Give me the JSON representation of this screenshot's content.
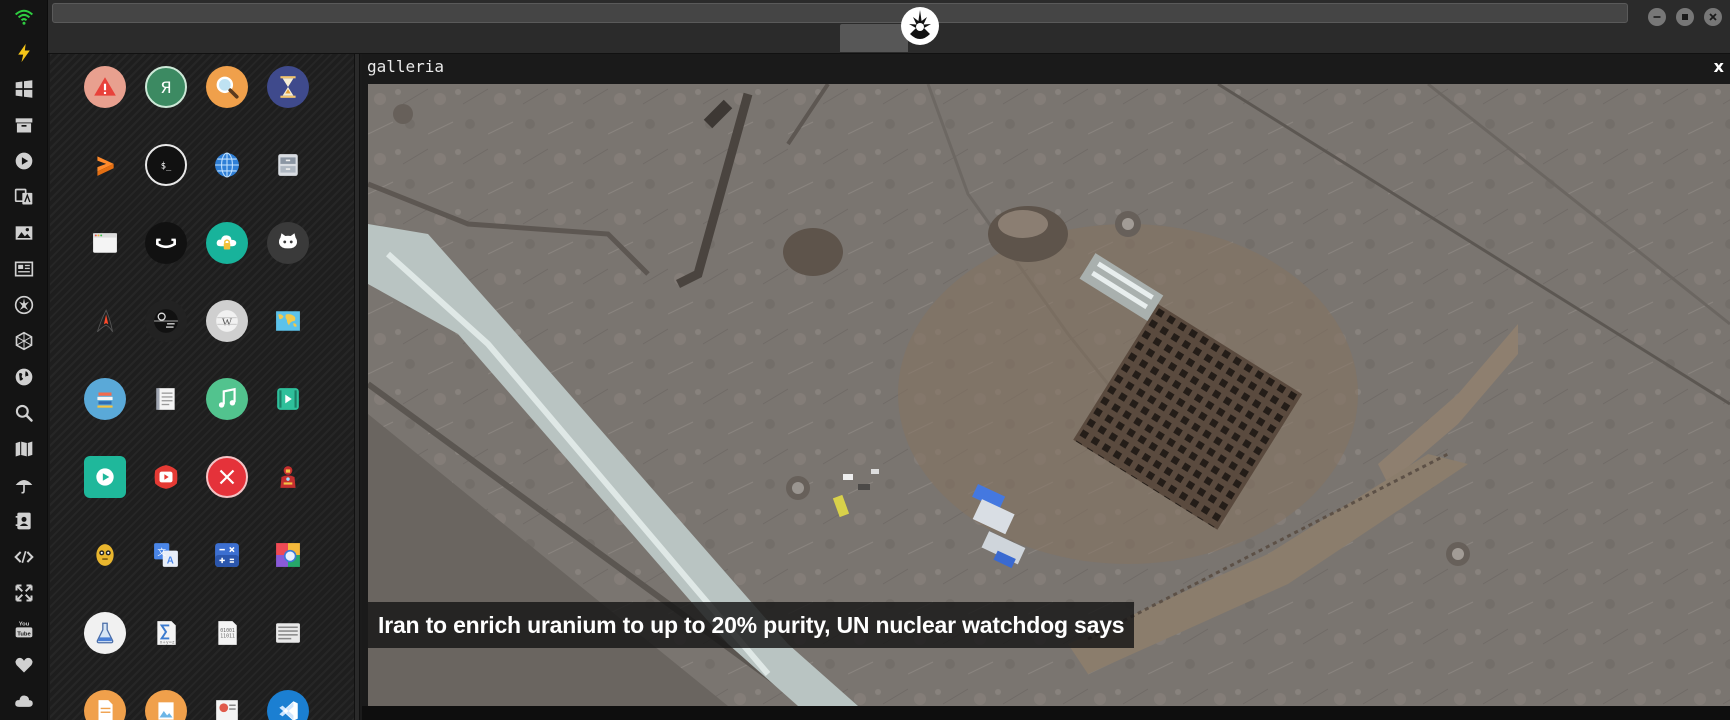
{
  "topbar": {
    "url_value": "",
    "buttons": [
      "minimize",
      "maximize",
      "close"
    ]
  },
  "dock": {
    "items": [
      "wifi-icon",
      "lightning-icon",
      "windows-icon",
      "archive-icon",
      "play-circle-icon",
      "translate-icon",
      "image-icon",
      "newspaper-icon",
      "rebel-alliance-icon",
      "hexagon-icon",
      "globe-icon",
      "search-icon",
      "map-icon",
      "umbrella-icon",
      "contacts-icon",
      "code-icon",
      "expand-icon",
      "youtube-icon",
      "heart-icon",
      "cloud-icon"
    ]
  },
  "apps": {
    "icons": [
      "warning-icon",
      "yandex-browser-icon",
      "search-icon",
      "hourglass-icon",
      "sublime-text-icon",
      "terminal-icon",
      "globe-icon",
      "file-manager-icon",
      "window-icon",
      "hammock-icon",
      "cloud-lock-icon",
      "github-icon",
      "starfleet-icon",
      "death-star-icon",
      "wikipedia-icon",
      "world-map-icon",
      "books-icon",
      "notebook-icon",
      "music-icon",
      "video-icon",
      "play-store-icon",
      "youtube-icon",
      "close-circle-icon",
      "iron-man-icon",
      "c3po-icon",
      "translate-icon",
      "calculator-icon",
      "color-picker-icon",
      "flask-icon",
      "formula-icon",
      "binary-file-icon",
      "text-file-icon",
      "document-icon",
      "photo-viewer-icon",
      "presentation-icon",
      "vscode-icon"
    ]
  },
  "gallery": {
    "title": "galleria",
    "close_label": "x",
    "caption": "Iran to enrich uranium to up to 20% purity, UN nuclear watchdog says"
  },
  "colors": {
    "background": "#1b1b1b",
    "dock_icon": "#d0d0d0",
    "accent_wifi": "#2ecc40",
    "lightning": "#f5c518"
  }
}
